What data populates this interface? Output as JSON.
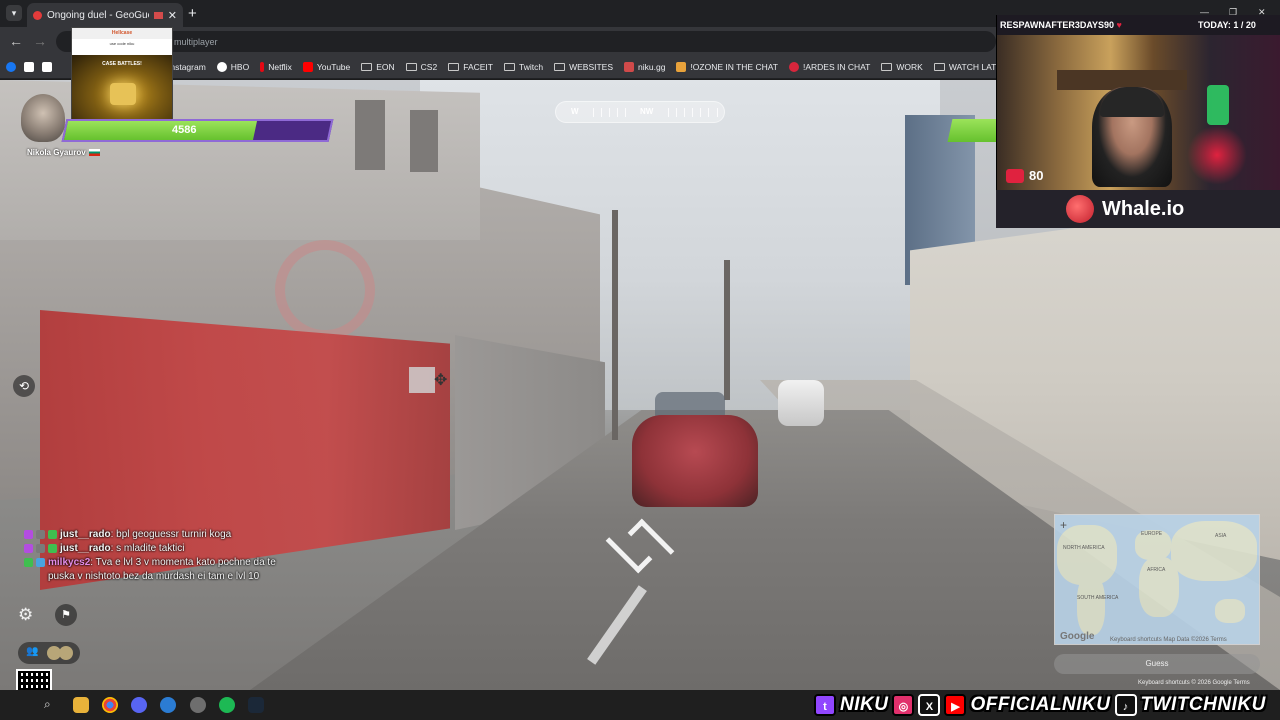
{
  "browser": {
    "tab_title": "Ongoing duel - GeoGuessr",
    "tab_close": "✕",
    "new_tab": "+",
    "url_partial": "multiplayer",
    "bookmarks": [
      {
        "label": "Instagram",
        "color": "#e1306c"
      },
      {
        "label": "HBO",
        "color": "#ffffff"
      },
      {
        "label": "Netflix",
        "color": "#e50914"
      },
      {
        "label": "YouTube",
        "color": "#ff0000"
      },
      {
        "label": "EON",
        "folder": true
      },
      {
        "label": "CS2",
        "folder": true
      },
      {
        "label": "FACEIT",
        "folder": true
      },
      {
        "label": "Twitch",
        "folder": true
      },
      {
        "label": "WEBSITES",
        "folder": true
      },
      {
        "label": "niku.gg",
        "color": "#d04a4a"
      },
      {
        "label": "!OZONE IN THE CHAT",
        "color": "#e8a23b"
      },
      {
        "label": "!ARDES IN CHAT",
        "color": "#d8263c"
      },
      {
        "label": "WORK",
        "folder": true
      },
      {
        "label": "WATCH LATER",
        "folder": true
      }
    ]
  },
  "ad_card": {
    "brand": "Hellcase",
    "sub": "use code niku",
    "title": "CASE BATTLES!"
  },
  "player": {
    "name": "Nikola Gyaurov",
    "health": 4586,
    "health_fraction": 0.72
  },
  "compass": {
    "west": "W",
    "heading": "NW"
  },
  "webcam": {
    "banner_title": "RESPAWNAFTER3DAYS90",
    "heart": "♥",
    "today": "TODAY: 1 / 20",
    "heart_rate": "80",
    "sponsor": "Whale.io"
  },
  "chat": [
    {
      "user": "just__rado",
      "user_color": "#f2f2f2",
      "message": "bpl geoguessr turniri koga"
    },
    {
      "user": "just__rado",
      "user_color": "#f2f2f2",
      "message": "s mladite taktici"
    },
    {
      "user": "milkycs2",
      "user_color": "#e28be8",
      "message": "Tva e lvl 3 v momenta kato pochne da te puska v nishtoto bez da murdash ei tam e lvl 10"
    }
  ],
  "map": {
    "labels": [
      "EUROPE",
      "AFRICA",
      "ASIA",
      "NORTH AMERICA",
      "SOUTH AMERICA"
    ],
    "footer": "Keyboard shortcuts   Map Data ©2026   Terms",
    "google": "Google",
    "guess_label": "Guess",
    "attribution": "Keyboard shortcuts   © 2026 Google   Terms"
  },
  "socials": {
    "twitch_handle": "NIKU",
    "official_handle": "OFFICIALNIKU",
    "tiktok_handle": "TWITCHNIKU"
  },
  "colors": {
    "health_green": "#66c12e",
    "health_purple": "#4b2a84"
  }
}
